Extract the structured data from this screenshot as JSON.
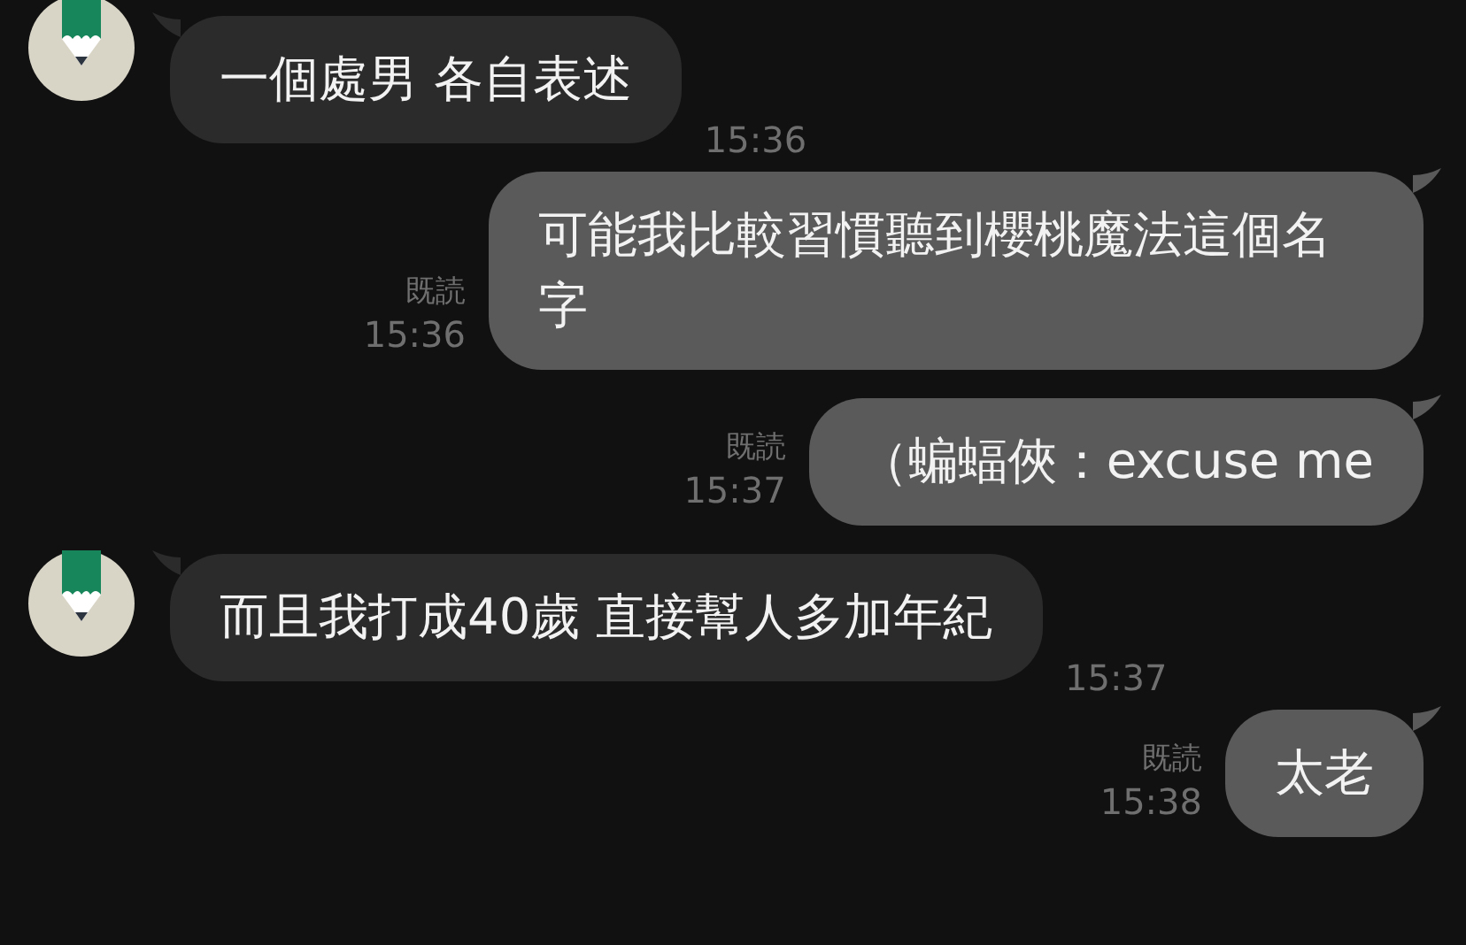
{
  "messages": [
    {
      "kind": "incoming",
      "text": "一個處男 各自表述",
      "time": "15:36"
    },
    {
      "kind": "outgoing",
      "text": "可能我比較習慣聽到櫻桃魔法這個名字",
      "read": "既読",
      "time": "15:36"
    },
    {
      "kind": "outgoing",
      "text": "（蝙蝠俠：excuse me",
      "read": "既読",
      "time": "15:37"
    },
    {
      "kind": "incoming",
      "text": "而且我打成40歲 直接幫人多加年紀",
      "time": "15:37"
    },
    {
      "kind": "outgoing",
      "text": "太老",
      "read": "既読",
      "time": "15:38"
    }
  ]
}
